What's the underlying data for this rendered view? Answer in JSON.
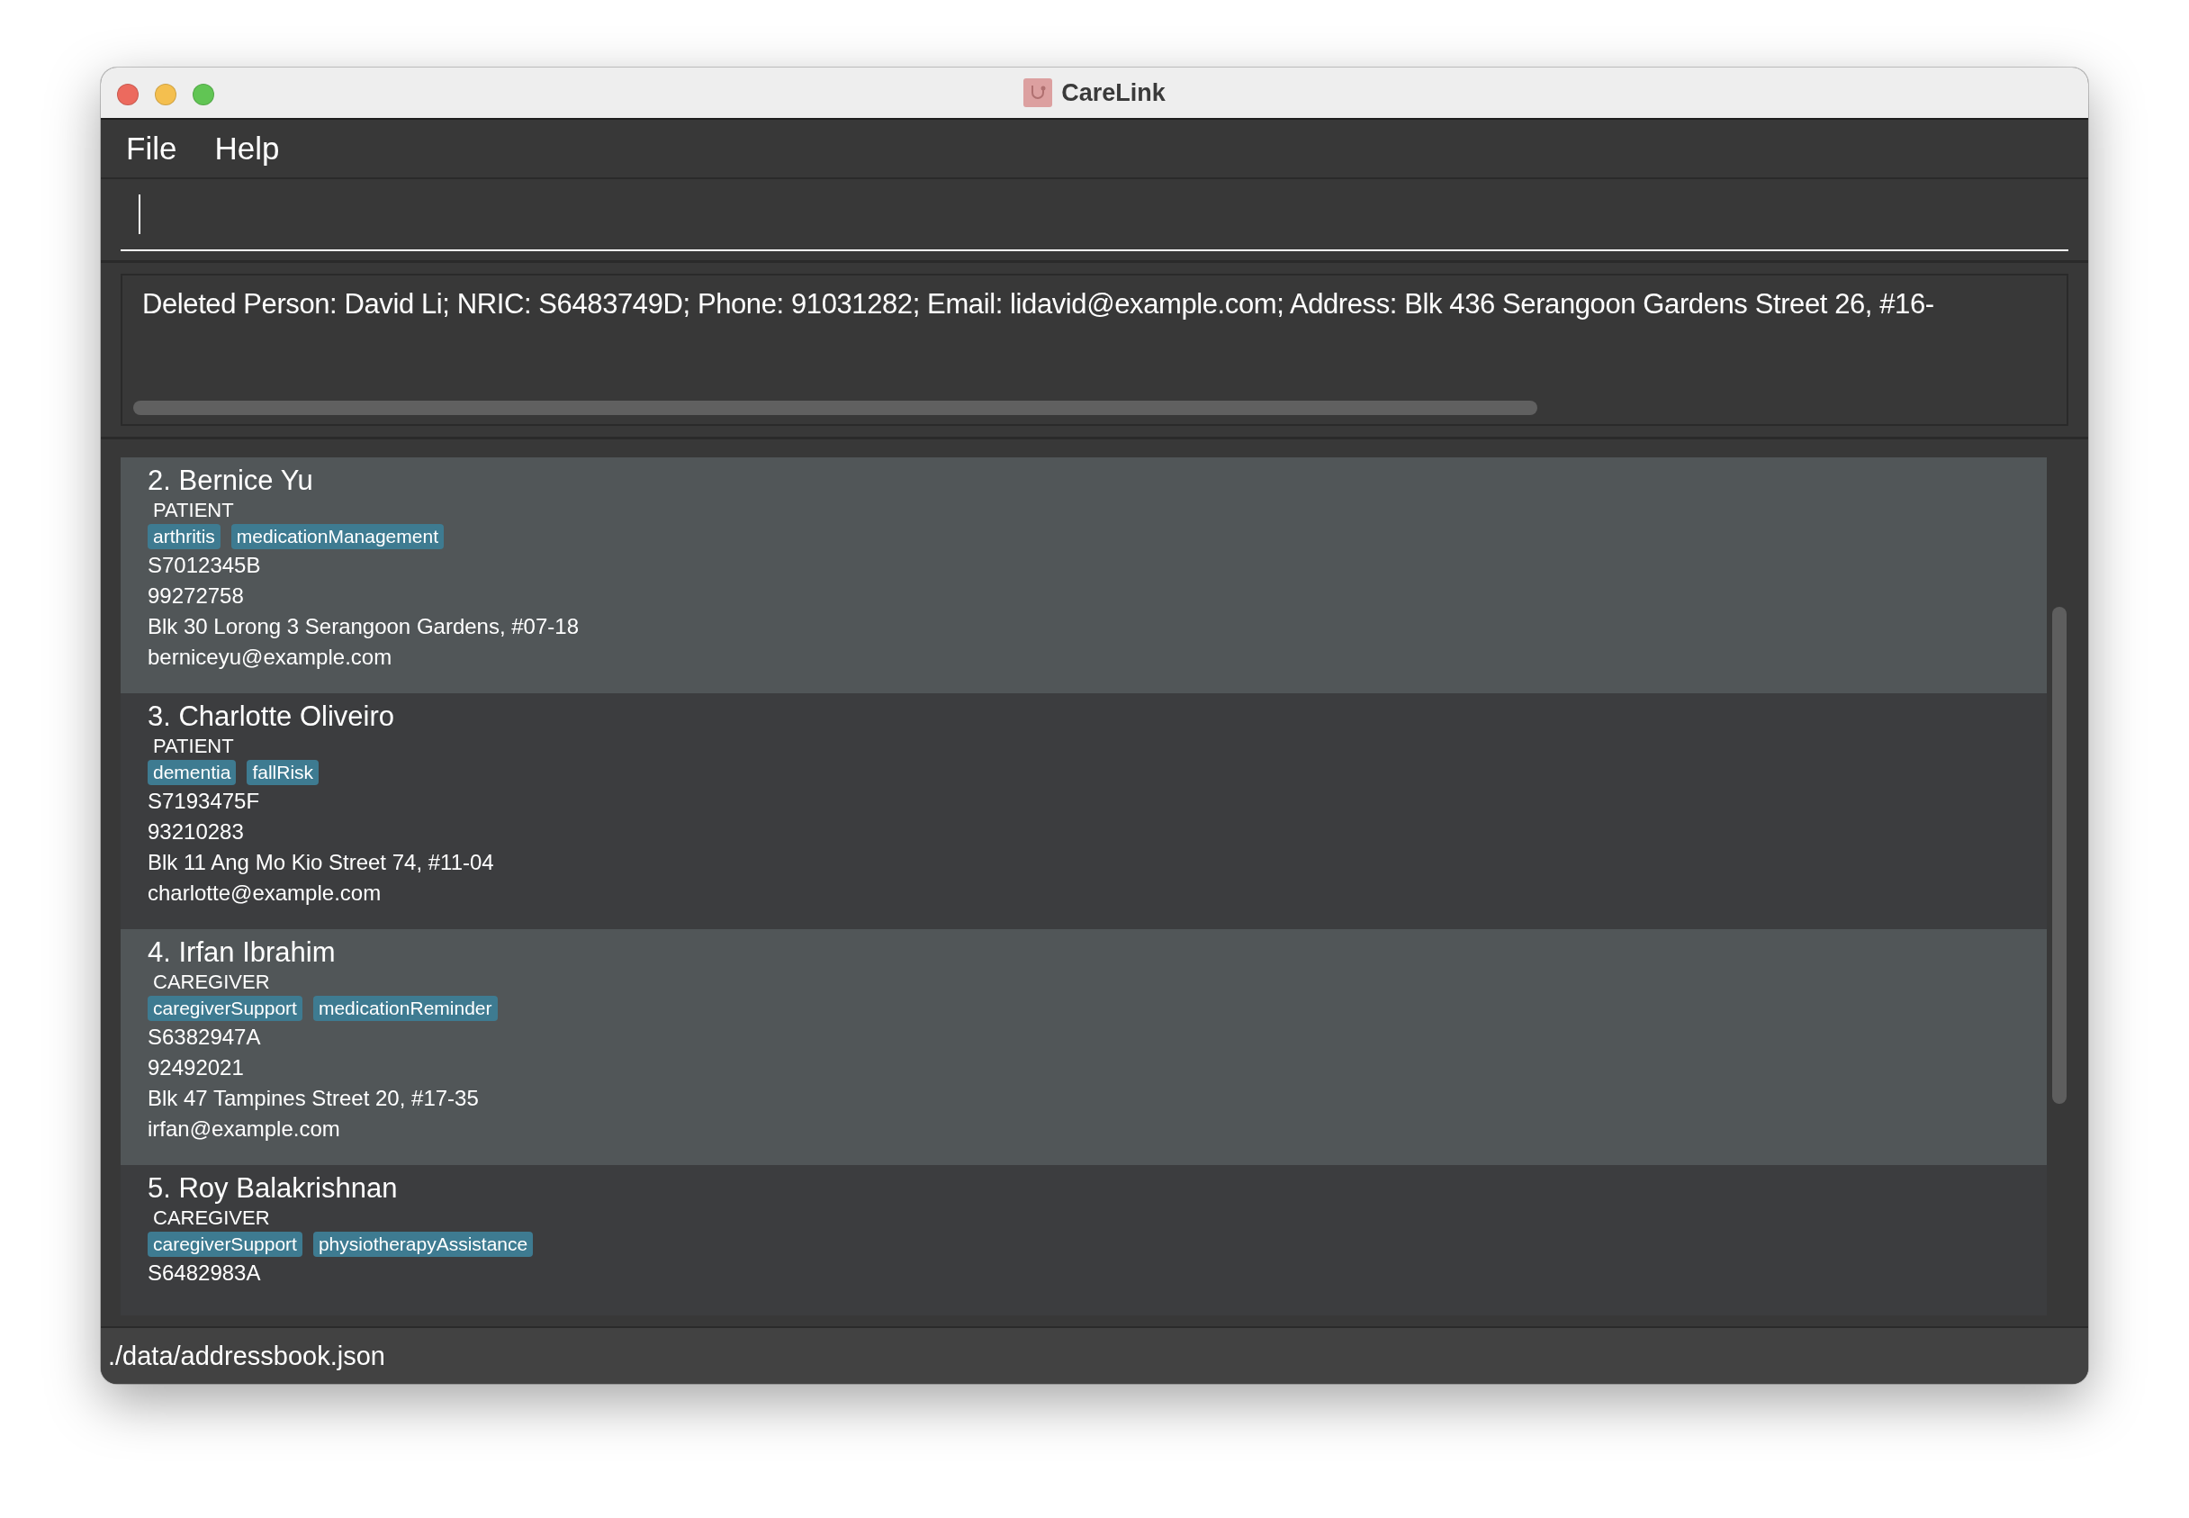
{
  "window": {
    "title": "CareLink"
  },
  "menu": [
    {
      "label": "File"
    },
    {
      "label": "Help"
    }
  ],
  "result": {
    "text": "Deleted Person: David Li; NRIC: S6483749D; Phone: 91031282; Email: lidavid@example.com; Address: Blk 436 Serangoon Gardens Street 26, #16-"
  },
  "persons": [
    {
      "number": "2.",
      "name": "Bernice Yu",
      "role": "PATIENT",
      "tags": [
        "arthritis",
        "medicationManagement"
      ],
      "details": [
        "S7012345B",
        "99272758",
        "Blk 30 Lorong 3 Serangoon Gardens, #07-18",
        "berniceyu@example.com"
      ]
    },
    {
      "number": "3.",
      "name": "Charlotte Oliveiro",
      "role": "PATIENT",
      "tags": [
        "dementia",
        "fallRisk"
      ],
      "details": [
        "S7193475F",
        "93210283",
        "Blk 11 Ang Mo Kio Street 74, #11-04",
        "charlotte@example.com"
      ]
    },
    {
      "number": "4.",
      "name": "Irfan Ibrahim",
      "role": "CAREGIVER",
      "tags": [
        "caregiverSupport",
        "medicationReminder"
      ],
      "details": [
        "S6382947A",
        "92492021",
        "Blk 47 Tampines Street 20, #17-35",
        "irfan@example.com"
      ]
    },
    {
      "number": "5.",
      "name": "Roy Balakrishnan",
      "role": "CAREGIVER",
      "tags": [
        "caregiverSupport",
        "physiotherapyAssistance"
      ],
      "details": [
        "S6482983A"
      ]
    }
  ],
  "status_bar": {
    "path": "./data/addressbook.json"
  }
}
